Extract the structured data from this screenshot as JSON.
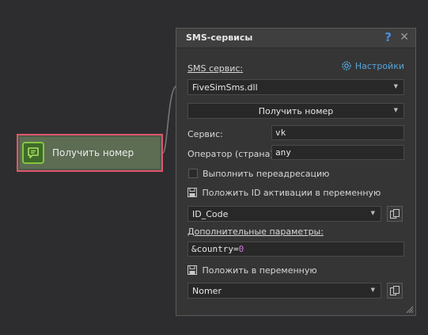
{
  "node": {
    "label": "Получить номер",
    "icon": "sms-chat-icon"
  },
  "panel": {
    "title": "SMS-сервисы",
    "help_glyph": "?",
    "close_glyph": "✕",
    "sms_service_label": "SMS сервис:",
    "settings_link": "Настройки",
    "sms_service_value": "FiveSimSms.dll",
    "action_value": "Получить номер",
    "service_label": "Сервис:",
    "service_value": "vk",
    "operator_label": "Оператор (страна):",
    "operator_value": "any",
    "redirect_label": "Выполнить переадресацию",
    "redirect_checked": false,
    "save_id_label": "Положить ID активации в переменную",
    "id_variable": "ID_Code",
    "extra_params_label": "Дополнительные параметры:",
    "extra_params_key": "&country=",
    "extra_params_num": "0",
    "save_to_var_label": "Положить в переменную",
    "result_variable": "Nomer"
  },
  "colors": {
    "background": "#2d2d30",
    "node_border": "#e0556a",
    "node_icon": "#86c540",
    "link": "#57a6dd",
    "help": "#4a8de0"
  }
}
